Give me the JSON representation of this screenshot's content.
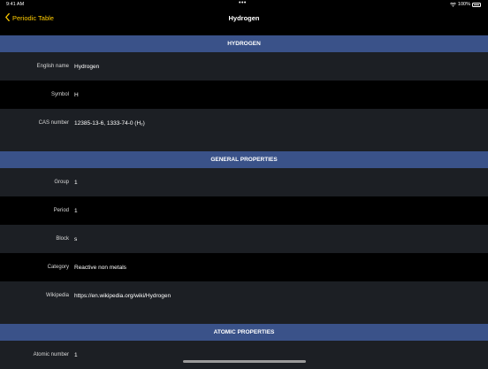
{
  "status_bar": {
    "time": "9:41 AM",
    "dots": "•••",
    "battery_text": "100%"
  },
  "nav": {
    "back_label": "Periodic Table",
    "title": "Hydrogen"
  },
  "sections": {
    "hydrogen": {
      "title": "HYDROGEN",
      "rows": [
        {
          "label": "English name",
          "value": "Hydrogen"
        },
        {
          "label": "Symbol",
          "value": "H"
        },
        {
          "label": "CAS number",
          "value": "12385-13-6, 1333-74-0 (H₂)"
        }
      ]
    },
    "general": {
      "title": "GENERAL PROPERTIES",
      "rows": [
        {
          "label": "Group",
          "value": "1"
        },
        {
          "label": "Period",
          "value": "1"
        },
        {
          "label": "Block",
          "value": "s"
        },
        {
          "label": "Category",
          "value": "Reactive non metals"
        },
        {
          "label": "Wikipedia",
          "value": "https://en.wikipedia.org/wiki/Hydrogen"
        }
      ]
    },
    "atomic": {
      "title": "ATOMIC PROPERTIES",
      "rows": [
        {
          "label": "Atomic number",
          "value": "1"
        }
      ]
    }
  },
  "colors": {
    "accent": "#ffcc00",
    "section_header": "#3a5289",
    "row_alt": "#1c1f24",
    "background": "#000000"
  }
}
